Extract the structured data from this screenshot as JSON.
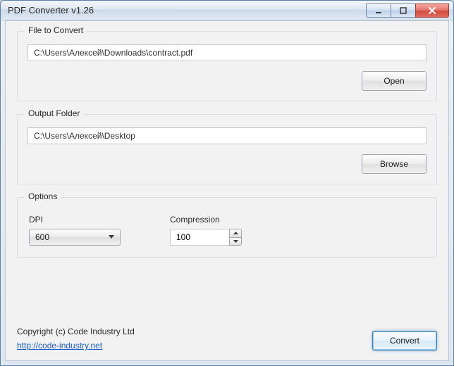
{
  "window": {
    "title": "PDF Converter v1.26"
  },
  "fileSection": {
    "legend": "File to Convert",
    "path": "C:\\Users\\Алексей\\Downloads\\contract.pdf",
    "openLabel": "Open"
  },
  "outputSection": {
    "legend": "Output Folder",
    "path": "C:\\Users\\Алексей\\Desktop",
    "browseLabel": "Browse"
  },
  "options": {
    "legend": "Options",
    "dpi": {
      "label": "DPI",
      "value": "600"
    },
    "compression": {
      "label": "Compression",
      "value": "100"
    }
  },
  "footer": {
    "copyright": "Copyright (c) Code Industry Ltd",
    "link": "http://code-industry.net",
    "convertLabel": "Convert"
  }
}
